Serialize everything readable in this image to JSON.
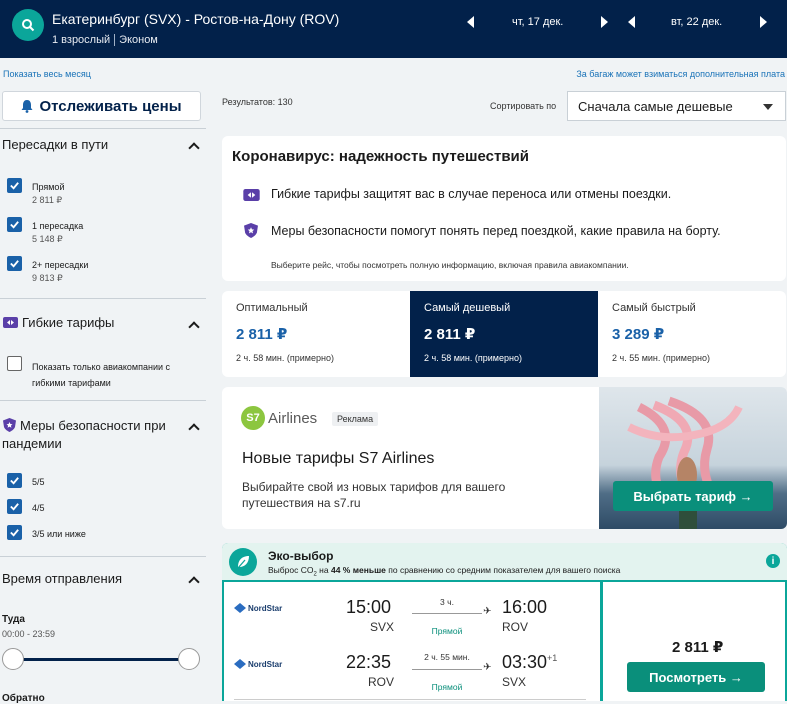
{
  "header": {
    "route": "Екатеринбург (SVX) - Ростов-на-Дону (ROV)",
    "passengers": "1 взрослый",
    "cabin": "Эконом",
    "depart_date": "чт, 17 дек.",
    "return_date": "вт, 22 дек."
  },
  "links": {
    "show_month": "Показать весь месяц",
    "baggage_note": "За багаж может взиматься дополнительная плата"
  },
  "track_button": "Отслеживать цены",
  "results_count": "Результатов: 130",
  "sort": {
    "label": "Сортировать по",
    "value": "Сначала самые дешевые"
  },
  "filters": {
    "stops_title": "Пересадки в пути",
    "stops": [
      {
        "label": "Прямой",
        "price": "2 811 ₽",
        "checked": true
      },
      {
        "label": "1 пересадка",
        "price": "5 148 ₽",
        "checked": true
      },
      {
        "label": "2+ пересадки",
        "price": "9 813 ₽",
        "checked": true
      }
    ],
    "flex_title": "Гибкие тарифы",
    "flex_option": "Показать только авиакомпании с гибкими тарифами",
    "safety_title": "Меры безопасности при пандемии",
    "safety": [
      "5/5",
      "4/5",
      "3/5 или ниже"
    ],
    "time_title": "Время отправления",
    "there_label": "Туда",
    "there_range": "00:00 - 23:59",
    "back_label": "Обратно"
  },
  "covid": {
    "title": "Коронавирус: надежность путешествий",
    "line1": "Гибкие тарифы защитят вас в случае переноса или отмены поездки.",
    "line2": "Меры безопасности помогут понять перед поездкой, какие правила на борту.",
    "note": "Выберите рейс, чтобы посмотреть полную информацию, включая правила авиакомпании."
  },
  "tabs": [
    {
      "title": "Оптимальный",
      "price": "2 811 ₽",
      "duration": "2 ч. 58 мин. (примерно)"
    },
    {
      "title": "Самый дешевый",
      "price": "2 811 ₽",
      "duration": "2 ч. 58 мин. (примерно)"
    },
    {
      "title": "Самый быстрый",
      "price": "3 289 ₽",
      "duration": "2 ч. 55 мин. (примерно)"
    }
  ],
  "ad": {
    "logo_mark": "S7",
    "logo_text": "Airlines",
    "badge": "Реклама",
    "title": "Новые тарифы S7 Airlines",
    "desc": "Выбирайте свой из новых тарифов для вашего путешествия на s7.ru",
    "button": "Выбрать тариф →"
  },
  "eco": {
    "title": "Эко-выбор",
    "sub_prefix": "Выброс CO",
    "sub_sub": "2",
    "sub_mid": " на ",
    "sub_bold": "44 % меньше",
    "sub_suffix": " по сравнению со средним показателем для вашего поиска",
    "info": "i"
  },
  "flights": [
    {
      "airline": "NordStar",
      "dep_time": "15:00",
      "dep_code": "SVX",
      "duration": "3 ч.",
      "stops": "Прямой",
      "arr_time": "16:00",
      "arr_code": "ROV",
      "day_offset": ""
    },
    {
      "airline": "NordStar",
      "dep_time": "22:35",
      "dep_code": "ROV",
      "duration": "2 ч. 55 мин.",
      "stops": "Прямой",
      "arr_time": "03:30",
      "arr_code": "SVX",
      "day_offset": "+1"
    }
  ],
  "offer": {
    "price": "2 811 ₽",
    "button": "Посмотреть →"
  },
  "colors": {
    "header_bg": "#02214a",
    "accent_teal": "#0ba69a",
    "button_green": "#0a8f7b",
    "link_blue": "#1a73b8",
    "checkbox_blue": "#1a61a8"
  }
}
